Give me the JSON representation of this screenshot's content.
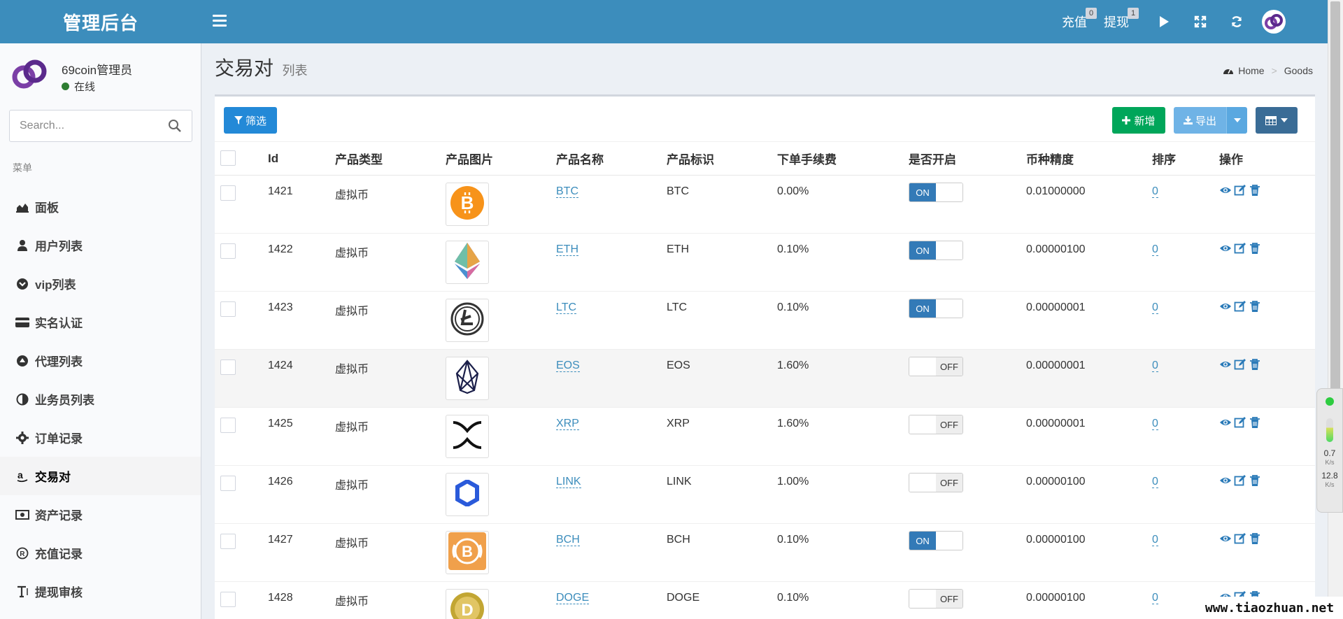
{
  "header": {
    "brand": "管理后台",
    "recharge_label": "充值",
    "recharge_count": "0",
    "withdraw_label": "提现",
    "withdraw_count": "1"
  },
  "user": {
    "name": "69coin管理员",
    "status": "在线"
  },
  "search": {
    "placeholder": "Search..."
  },
  "menu": {
    "header": "菜单",
    "items": [
      {
        "label": "面板",
        "icon": "area-chart-icon"
      },
      {
        "label": "用户列表",
        "icon": "user-secret-icon"
      },
      {
        "label": "vip列表",
        "icon": "chevron-circle-down-icon"
      },
      {
        "label": "实名认证",
        "icon": "credit-card-icon"
      },
      {
        "label": "代理列表",
        "icon": "eject-circle-icon"
      },
      {
        "label": "业务员列表",
        "icon": "adjust-icon"
      },
      {
        "label": "订单记录",
        "icon": "cog-icon"
      },
      {
        "label": "交易对",
        "icon": "amazon-icon"
      },
      {
        "label": "资产记录",
        "icon": "money-icon"
      },
      {
        "label": "充值记录",
        "icon": "registered-icon"
      },
      {
        "label": "提现审核",
        "icon": "text-height-icon"
      }
    ]
  },
  "page": {
    "title": "交易对",
    "subtitle": "列表",
    "breadcrumb_home": "Home",
    "breadcrumb_current": "Goods"
  },
  "toolbar": {
    "filter": "筛选",
    "add": "新增",
    "export": "导出"
  },
  "table": {
    "headers": [
      "Id",
      "产品类型",
      "产品图片",
      "产品名称",
      "产品标识",
      "下单手续费",
      "是否开启",
      "币种精度",
      "排序",
      "操作"
    ],
    "rows": [
      {
        "id": "1421",
        "type": "虚拟币",
        "name": "BTC",
        "symbol": "BTC",
        "fee": "0.00%",
        "enabled": "ON",
        "precision": "0.01000000",
        "sort": "0",
        "coin": "btc"
      },
      {
        "id": "1422",
        "type": "虚拟币",
        "name": "ETH",
        "symbol": "ETH",
        "fee": "0.10%",
        "enabled": "ON",
        "precision": "0.00000100",
        "sort": "0",
        "coin": "eth"
      },
      {
        "id": "1423",
        "type": "虚拟币",
        "name": "LTC",
        "symbol": "LTC",
        "fee": "0.10%",
        "enabled": "ON",
        "precision": "0.00000001",
        "sort": "0",
        "coin": "ltc"
      },
      {
        "id": "1424",
        "type": "虚拟币",
        "name": "EOS",
        "symbol": "EOS",
        "fee": "1.60%",
        "enabled": "OFF",
        "precision": "0.00000001",
        "sort": "0",
        "coin": "eos"
      },
      {
        "id": "1425",
        "type": "虚拟币",
        "name": "XRP",
        "symbol": "XRP",
        "fee": "1.60%",
        "enabled": "OFF",
        "precision": "0.00000001",
        "sort": "0",
        "coin": "xrp"
      },
      {
        "id": "1426",
        "type": "虚拟币",
        "name": "LINK",
        "symbol": "LINK",
        "fee": "1.00%",
        "enabled": "OFF",
        "precision": "0.00000100",
        "sort": "0",
        "coin": "link"
      },
      {
        "id": "1427",
        "type": "虚拟币",
        "name": "BCH",
        "symbol": "BCH",
        "fee": "0.10%",
        "enabled": "ON",
        "precision": "0.00000100",
        "sort": "0",
        "coin": "bch"
      },
      {
        "id": "1428",
        "type": "虚拟币",
        "name": "DOGE",
        "symbol": "DOGE",
        "fee": "0.10%",
        "enabled": "OFF",
        "precision": "0.00000100",
        "sort": "0",
        "coin": "doge"
      }
    ]
  },
  "net_widget": {
    "up": "0.7",
    "up_unit": "K/s",
    "down": "12.8",
    "down_unit": "K/s"
  },
  "watermark": "www.tiaozhuan.net",
  "colors": {
    "header": "#3c8dbc",
    "filter_button": "#2389d7",
    "add_button": "#00a65a",
    "switch_on": "#337ab7"
  }
}
